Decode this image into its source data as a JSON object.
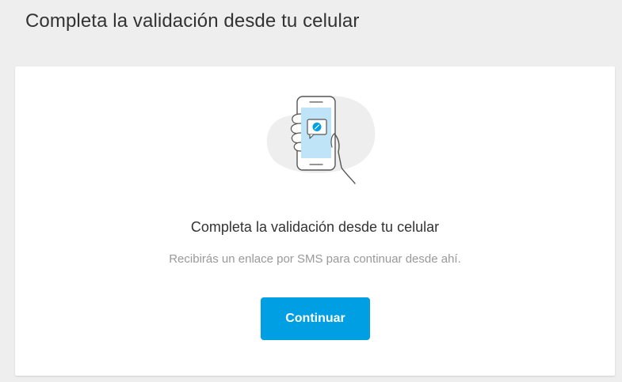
{
  "header": {
    "title": "Completa la validación desde tu celular"
  },
  "card": {
    "illustration_icon": "phone-in-hand-with-message-icon",
    "title": "Completa la validación desde tu celular",
    "subtitle": "Recibirás un enlace por SMS para continuar desde ahí.",
    "continue_label": "Continuar"
  },
  "colors": {
    "background": "#eeeeee",
    "card": "#ffffff",
    "accent": "#009ee3",
    "title_text": "#333333",
    "muted_text": "#999999",
    "illustration_blob": "#eeeeee",
    "phone_screen": "#bfe3f7"
  }
}
